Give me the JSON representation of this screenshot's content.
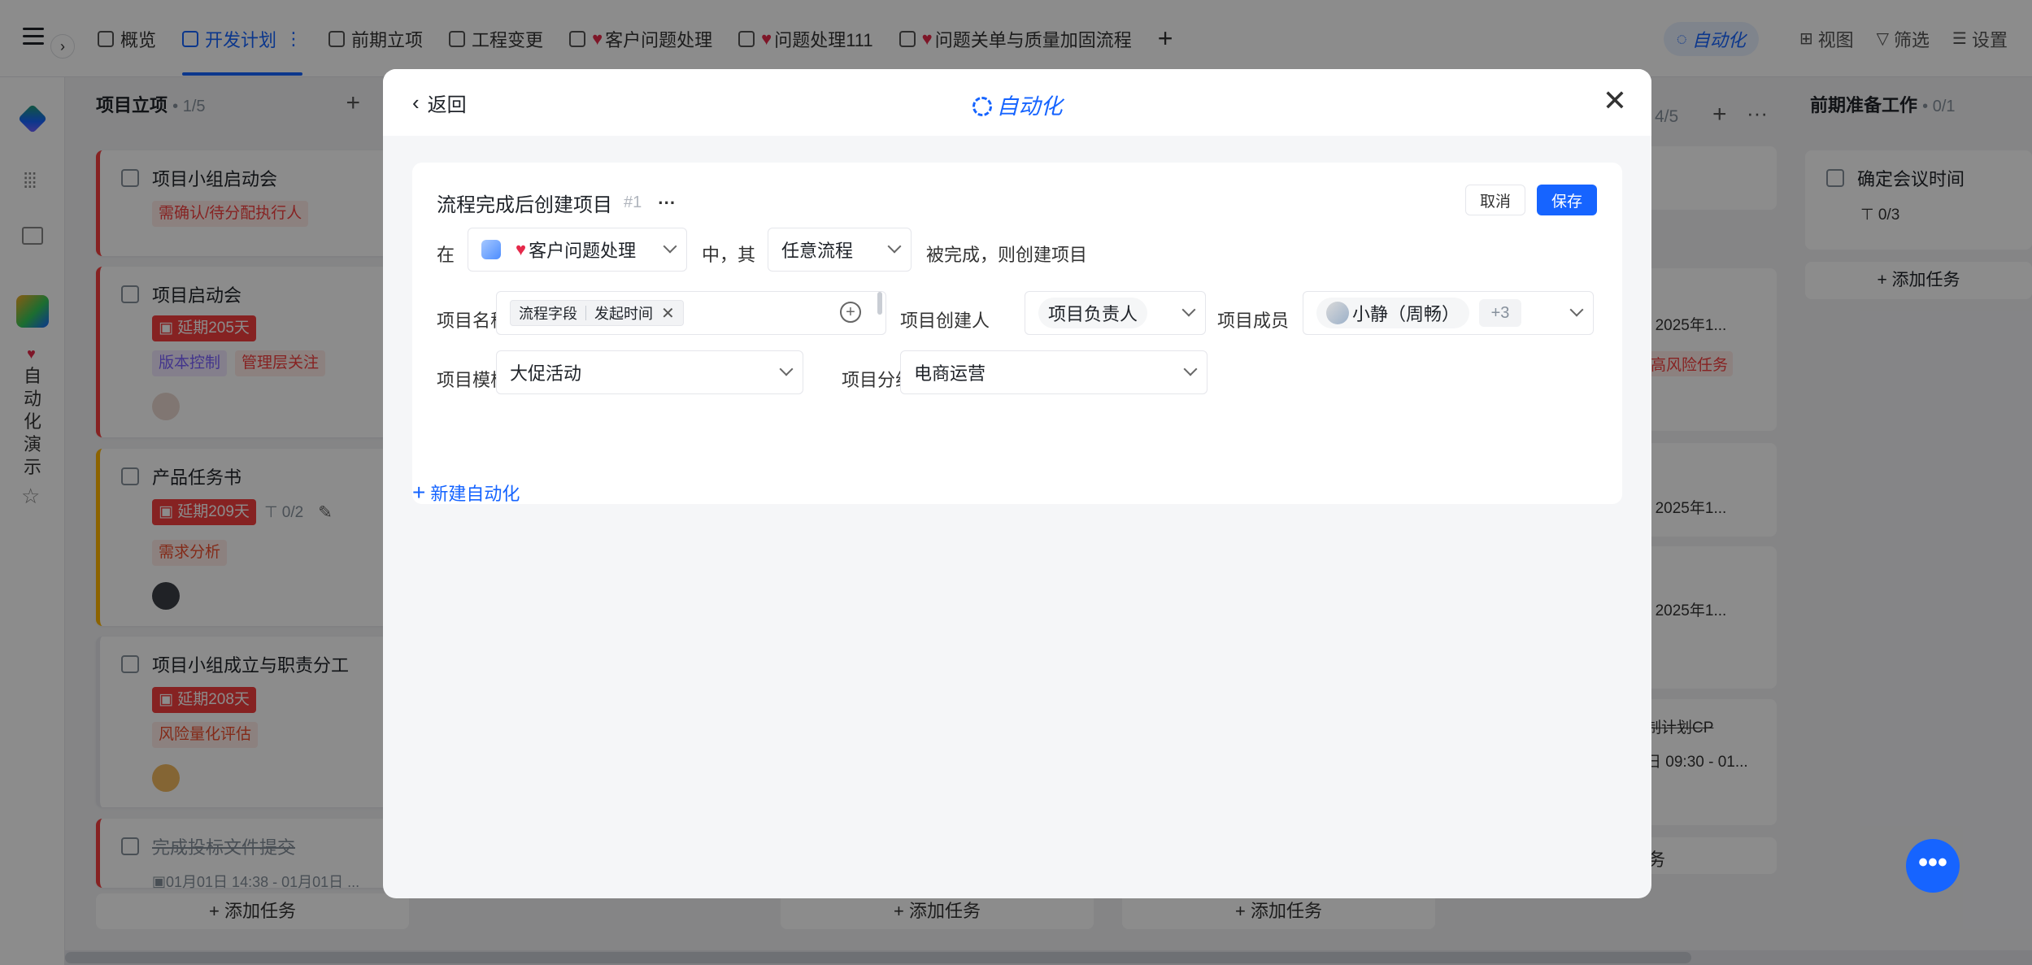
{
  "topbar": {
    "tabs": [
      {
        "label": "概览",
        "heart": false
      },
      {
        "label": "开发计划",
        "heart": false,
        "active": true
      },
      {
        "label": "前期立项",
        "heart": false
      },
      {
        "label": "工程变更",
        "heart": false
      },
      {
        "label": "客户问题处理",
        "heart": true
      },
      {
        "label": "问题处理111",
        "heart": true
      },
      {
        "label": "问题关单与质量加固流程",
        "heart": true
      }
    ],
    "tab_more": "⋮",
    "add_tab": "+",
    "automation": "自动化",
    "view": "视图",
    "filter": "筛选",
    "settings": "设置"
  },
  "sidebar": {
    "project_name": "自动化演示",
    "heart": "♥"
  },
  "board": {
    "col1": {
      "title": "项目立项",
      "count": "• 1/5",
      "cards": [
        {
          "title": "项目小组启动会",
          "tags": [
            "需确认/待分配执行人"
          ]
        },
        {
          "title": "项目启动会",
          "overdue": "延期205天",
          "tags": [
            "版本控制",
            "管理层关注"
          ]
        },
        {
          "title": "产品任务书",
          "overdue": "延期209天",
          "subtasks": "0/2",
          "tags": [
            "需求分析"
          ]
        },
        {
          "title": "项目小组成立与职责分工",
          "overdue": "延期208天",
          "tags": [
            "风险量化评估"
          ]
        },
        {
          "title": "完成投标文件提交",
          "date": "01月01日 14:38 - 01月01日 ..."
        }
      ]
    },
    "col4_count": "4/5",
    "col5": {
      "title": "前期准备工作",
      "count": "• 0/1",
      "card_title": "确定会议时间",
      "subtasks": "0/3"
    },
    "right_snippets": {
      "date1": "- 2025年1...",
      "tag1": "高风险任务",
      "date2": "- 2025年1...",
      "date3": "- 2025年1...",
      "text4": "制计划CP",
      "date4": "日 09:30 - 01...",
      "add5": "务"
    },
    "add_task": "添加任务"
  },
  "modal": {
    "back": "返回",
    "title": "自动化",
    "rule": {
      "name": "流程完成后创建项目",
      "index": "#1",
      "more": "···",
      "cancel": "取消",
      "save": "保存",
      "in_label": "在",
      "source": "客户问题处理",
      "middle_label": "中，其",
      "flow": "任意流程",
      "trigger_text": "被完成，则创建项目",
      "project_name_label": "项目名称",
      "chip_field": "流程字段",
      "chip_value": "发起时间",
      "creator_label": "项目创建人",
      "creator_value": "项目负责人",
      "members_label": "项目成员",
      "member_name": "小静（周畅）",
      "member_more": "+3",
      "template_label": "项目模板",
      "template_value": "大促活动",
      "group_label": "项目分组",
      "group_value": "电商运营"
    },
    "new_automation": "新建自动化"
  },
  "fab": "•••"
}
